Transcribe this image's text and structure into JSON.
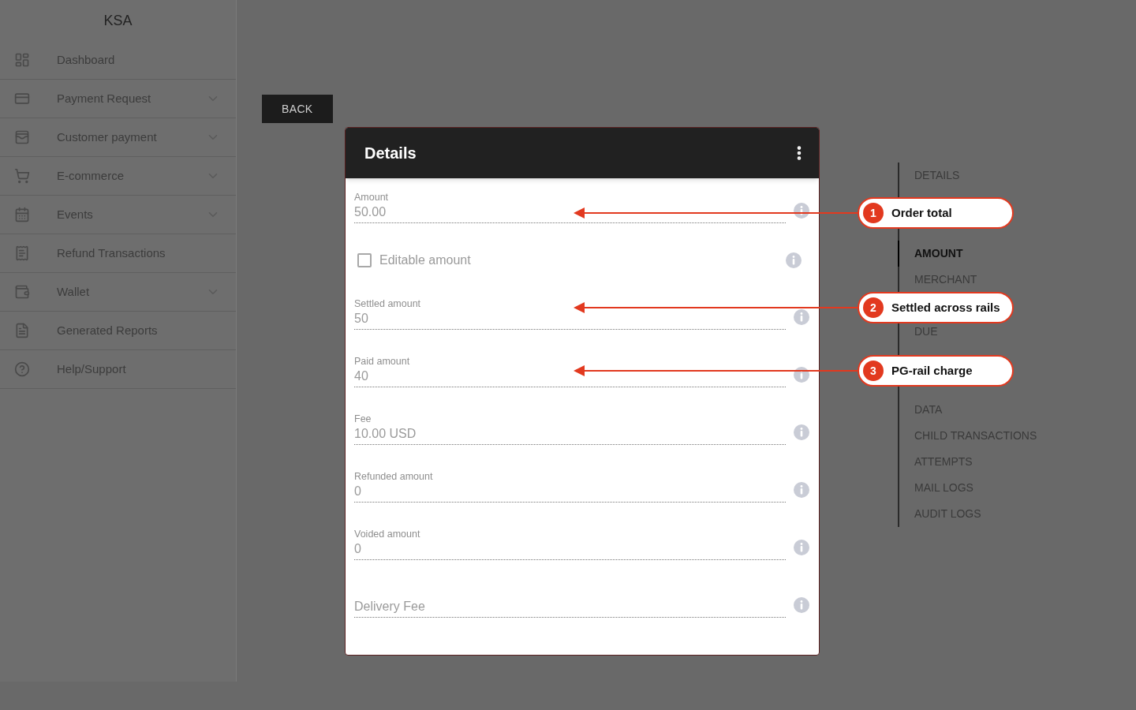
{
  "sidebar": {
    "title": "KSA",
    "items": [
      {
        "label": "Dashboard",
        "expandable": false
      },
      {
        "label": "Payment Request",
        "expandable": true
      },
      {
        "label": "Customer payment",
        "expandable": true
      },
      {
        "label": "E-commerce",
        "expandable": true
      },
      {
        "label": "Events",
        "expandable": true
      },
      {
        "label": "Refund Transactions",
        "expandable": false
      },
      {
        "label": "Wallet",
        "expandable": true
      },
      {
        "label": "Generated Reports",
        "expandable": false
      },
      {
        "label": "Help/Support",
        "expandable": false
      }
    ]
  },
  "back_button": "BACK",
  "details_card": {
    "title": "Details",
    "fields": [
      {
        "kind": "field",
        "label": "Amount",
        "value": "50.00"
      },
      {
        "kind": "checkbox",
        "label": "Editable amount",
        "checked": false
      },
      {
        "kind": "field",
        "label": "Settled amount",
        "value": "50"
      },
      {
        "kind": "field",
        "label": "Paid amount",
        "value": "40"
      },
      {
        "kind": "field",
        "label": "Fee",
        "value": "10.00 USD"
      },
      {
        "kind": "field",
        "label": "Refunded amount",
        "value": "0"
      },
      {
        "kind": "field",
        "label": "Voided amount",
        "value": "0"
      },
      {
        "kind": "field",
        "placeholder": "Delivery Fee"
      }
    ]
  },
  "section_nav": {
    "items": [
      {
        "label": "DETAILS",
        "selected": false
      },
      {
        "label": "AMOUNT",
        "selected": true
      },
      {
        "label": "MERCHANT",
        "selected": false
      },
      {
        "label": "DUE",
        "selected": false
      },
      {
        "label": "DATA",
        "selected": false
      },
      {
        "label": "CHILD TRANSACTIONS",
        "selected": false
      },
      {
        "label": "ATTEMPTS",
        "selected": false
      },
      {
        "label": "MAIL LOGS",
        "selected": false
      },
      {
        "label": "AUDIT LOGS",
        "selected": false
      }
    ]
  },
  "annotations": [
    {
      "number": "1",
      "text": "Order total"
    },
    {
      "number": "2",
      "text": "Settled across rails"
    },
    {
      "number": "3",
      "text": "PG-rail charge"
    }
  ]
}
